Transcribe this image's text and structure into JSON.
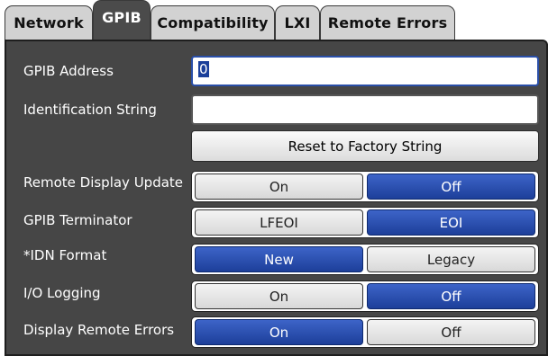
{
  "tabs": [
    {
      "label": "Network",
      "active": false
    },
    {
      "label": "GPIB",
      "active": true
    },
    {
      "label": "Compatibility",
      "active": false
    },
    {
      "label": "LXI",
      "active": false
    },
    {
      "label": "Remote Errors",
      "active": false
    }
  ],
  "gpib_address": {
    "label": "GPIB Address",
    "value": "0"
  },
  "identification_string": {
    "label": "Identification String",
    "value": ""
  },
  "reset_button": {
    "label": "Reset to Factory String"
  },
  "remote_display_update": {
    "label": "Remote Display Update",
    "options": [
      "On",
      "Off"
    ],
    "selected": "Off"
  },
  "gpib_terminator": {
    "label": "GPIB Terminator",
    "options": [
      "LFEOI",
      "EOI"
    ],
    "selected": "EOI"
  },
  "idn_format": {
    "label": "*IDN Format",
    "options": [
      "New",
      "Legacy"
    ],
    "selected": "New"
  },
  "io_logging": {
    "label": "I/O Logging",
    "options": [
      "On",
      "Off"
    ],
    "selected": "Off"
  },
  "display_remote_errors": {
    "label": "Display Remote Errors",
    "options": [
      "On",
      "Off"
    ],
    "selected": "On"
  },
  "colors": {
    "panel": "#464646",
    "selected": "#1d3f9a",
    "tab_inactive": "#d2d2d2",
    "tab_active": "#4b4b4b"
  }
}
